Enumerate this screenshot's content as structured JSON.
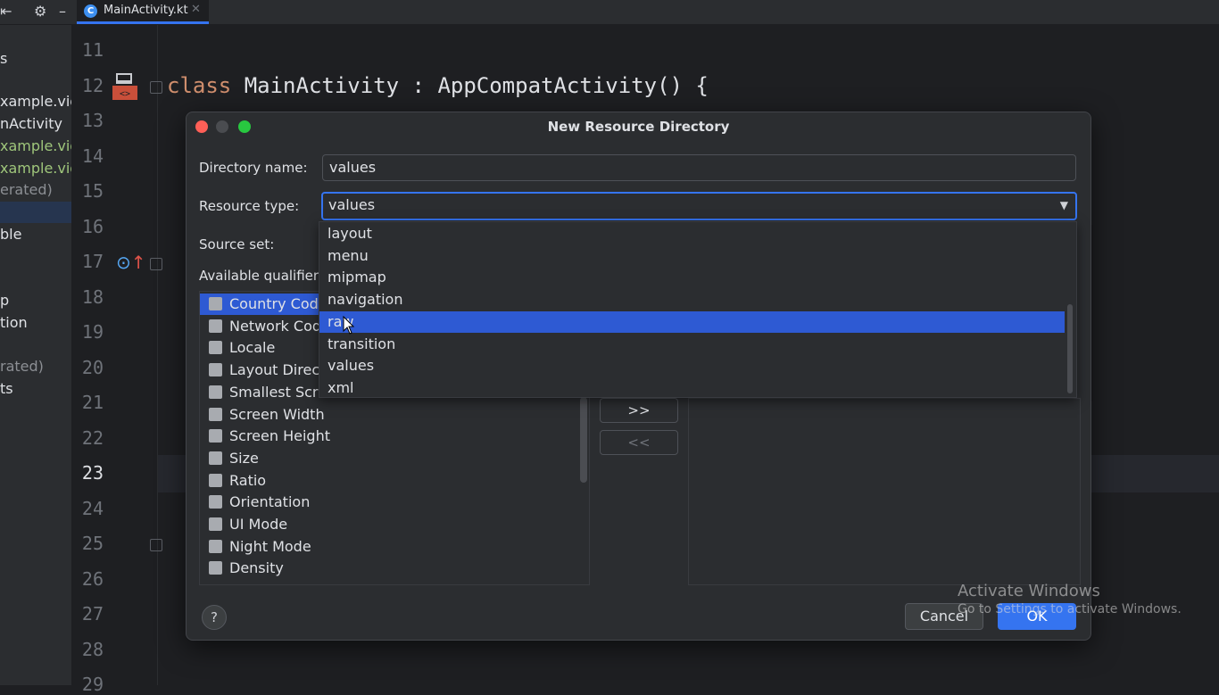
{
  "window": {
    "tab": {
      "label": "MainActivity.kt",
      "close": "✕"
    }
  },
  "project_panel": {
    "items": [
      {
        "text": "s",
        "tone": "normal"
      },
      {
        "text": "xample.vide",
        "tone": "normal"
      },
      {
        "text": "nActivity",
        "tone": "normal"
      },
      {
        "text": "xample.vide",
        "tone": "green"
      },
      {
        "text": "xample.vide",
        "tone": "green"
      },
      {
        "text": "erated)",
        "tone": "gray"
      },
      {
        "text": "ble",
        "tone": "normal"
      },
      {
        "text": "p",
        "tone": "normal"
      },
      {
        "text": "tion",
        "tone": "normal"
      },
      {
        "text": "rated)",
        "tone": "gray"
      },
      {
        "text": "ts",
        "tone": "normal"
      }
    ]
  },
  "editor": {
    "line_numbers": [
      "11",
      "12",
      "13",
      "14",
      "15",
      "16",
      "17",
      "18",
      "19",
      "20",
      "21",
      "22",
      "23",
      "24",
      "25",
      "26",
      "27",
      "28",
      "29"
    ],
    "current_line": "23",
    "code": {
      "keyword": "class",
      "rest": " MainActivity : AppCompatActivity() {"
    }
  },
  "dialog": {
    "title": "New Resource Directory",
    "directory_name_label": "Directory name:",
    "directory_name_value": "values",
    "resource_type_label": "Resource type:",
    "resource_type_value": "values",
    "source_set_label": "Source set:",
    "available_qualifiers_label": "Available qualifier",
    "qualifiers": [
      "Country Code",
      "Network Code",
      "Locale",
      "Layout Direction",
      "Smallest Screen",
      "Screen Width",
      "Screen Height",
      "Size",
      "Ratio",
      "Orientation",
      "UI Mode",
      "Night Mode",
      "Density"
    ],
    "selected_qualifier_index": 0,
    "add_button": ">>",
    "remove_button": "<<",
    "help": "?",
    "cancel": "Cancel",
    "ok": "OK"
  },
  "dropdown": {
    "options": [
      "layout",
      "menu",
      "mipmap",
      "navigation",
      "raw",
      "transition",
      "values",
      "xml"
    ],
    "highlighted": "raw"
  },
  "watermark": {
    "title": "Activate Windows",
    "subtitle": "Go to Settings to activate Windows."
  },
  "colors": {
    "accent": "#3574f0",
    "selection": "#2e5ad3",
    "keyword": "#cf8e6d",
    "close_red": "#ff5f57",
    "zoom_green": "#28c840"
  }
}
